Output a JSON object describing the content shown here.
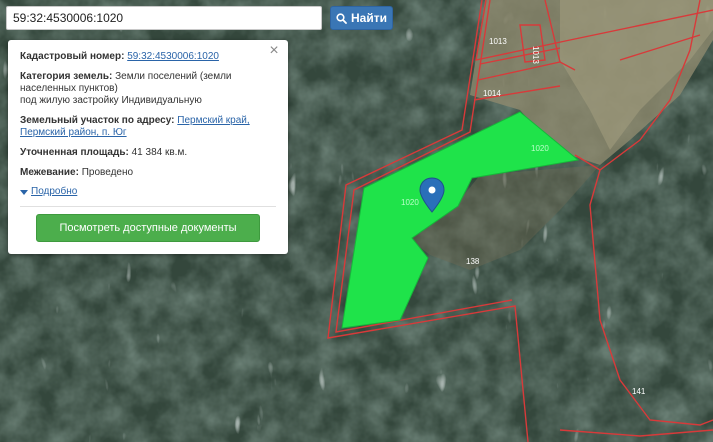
{
  "search": {
    "value": "59:32:4530006:1020",
    "button_label": "Найти"
  },
  "parcel": {
    "cadastral_label": "Кадастровый номер:",
    "cadastral_number": "59:32:4530006:1020",
    "category_label": "Категория земель:",
    "category_value": "Земли поселений (земли населенных пунктов)",
    "use_value": "под жилую застройку Индивидуальную",
    "address_label": "Земельный участок по адресу:",
    "address_line1": "Пермский край,",
    "address_line2": "Пермский район, п. Юг",
    "area_label": "Уточненная площадь:",
    "area_value": "41 384 кв.м.",
    "survey_label": "Межевание:",
    "survey_value": "Проведено",
    "more_link": "Подробно",
    "docs_button": "Посмотреть доступные документы"
  },
  "map_labels": {
    "p1013a": "1013",
    "p1013b": "1013",
    "p1014": "1014",
    "p1020a": "1020",
    "p1020b": "1020",
    "p138": "138",
    "p141": "141"
  },
  "colors": {
    "parcel_fill": "#1fe34a",
    "boundary": "#d83a3a",
    "search_button": "#3a76b5",
    "docs_button": "#4cae4c",
    "marker": "#2a6fb9"
  },
  "icons": {
    "search_button": "search-icon",
    "close": "close-icon",
    "marker": "map-marker-icon",
    "more": "triangle-down-icon"
  }
}
